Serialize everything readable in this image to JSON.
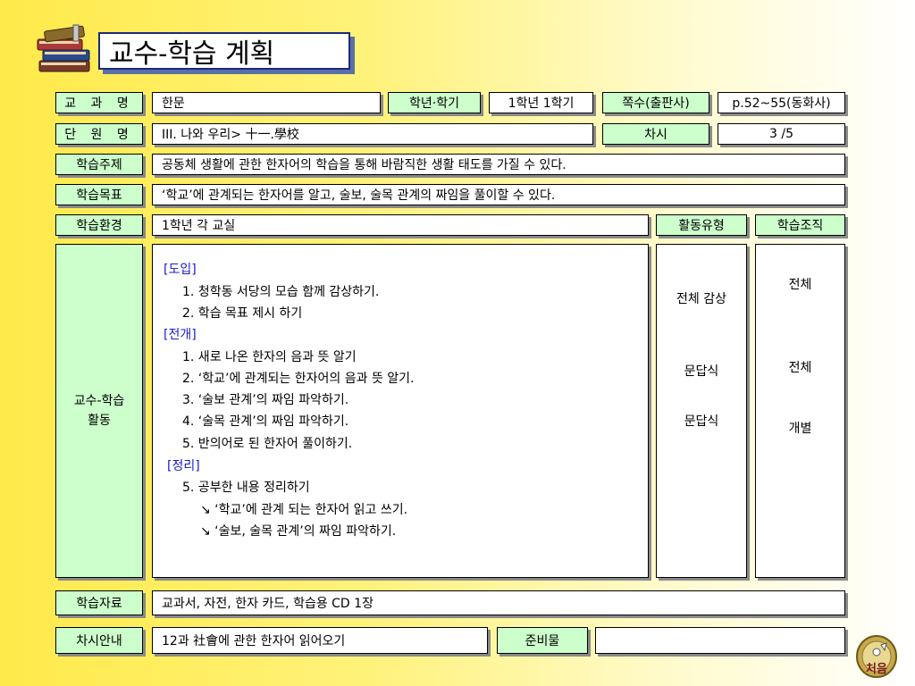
{
  "header": {
    "title": "교수-학습 계획"
  },
  "row1": {
    "subject_label": "교 과 명",
    "subject_value": "한문",
    "grade_label": "학년·학기",
    "grade_value": "1학년 1학기",
    "pages_label": "쪽수(출판사)",
    "pages_value": "p.52~55(동화사)"
  },
  "row2": {
    "unit_label": "단 원 명",
    "unit_value": "III. 나와 우리> 十一.學校",
    "session_label": "차시",
    "session_value": "3 /5"
  },
  "row3": {
    "topic_label": "학습주제",
    "topic_value": "공동체 생활에 관한 한자어의 학습을 통해 바람직한 생활 태도를 가질 수 있다."
  },
  "row4": {
    "goal_label": "학습목표",
    "goal_value": "‘학교’에 관계되는 한자어를 알고, 술보, 술목 관계의 짜임을 풀이할 수 있다."
  },
  "row5": {
    "env_label": "학습환경",
    "env_value": "1학년 각 교실",
    "type_label": "활동유형",
    "org_label": "학습조직"
  },
  "activity": {
    "label_line1": "교수-학습",
    "label_line2": "활동",
    "lines": [
      "[도입]",
      "1. 청학동 서당의 모습 함께 감상하기.",
      "2. 학습 목표 제시 하기",
      "[전개]",
      "1. 새로 나온 한자의 음과 뜻 알기",
      "2. ‘학교’에 관계되는 한자어의 음과 뜻 알기.",
      "3. ‘술보 관계’의 짜임 파악하기.",
      "4. ‘술목 관계’의 짜임 파악하기.",
      "5. 반의어로 된 한자어 풀이하기.",
      "[정리]",
      "5. 공부한 내용 정리하기",
      "↘ ‘학교’에 관계 되는 한자어 읽고 쓰기.",
      "↘ ‘술보, 술목 관계’의 짜임 파악하기."
    ],
    "types": [
      "전체 감상",
      "문답식",
      "문답식"
    ],
    "orgs": [
      "전체",
      "전체",
      "개별"
    ]
  },
  "row7": {
    "materials_label": "학습자료",
    "materials_value": "교과서, 자전, 한자 카드, 학습용 CD 1장"
  },
  "row8": {
    "next_label": "차시안내",
    "next_value": "12과 社會에 관한 한자어 읽어오기",
    "prep_label": "준비물",
    "prep_value": ""
  },
  "nav": {
    "first_label": "처음"
  },
  "colors": {
    "label_bg": "#ccffcc",
    "accent_blue": "#1a1acc",
    "title_border": "#1a2a7a"
  }
}
